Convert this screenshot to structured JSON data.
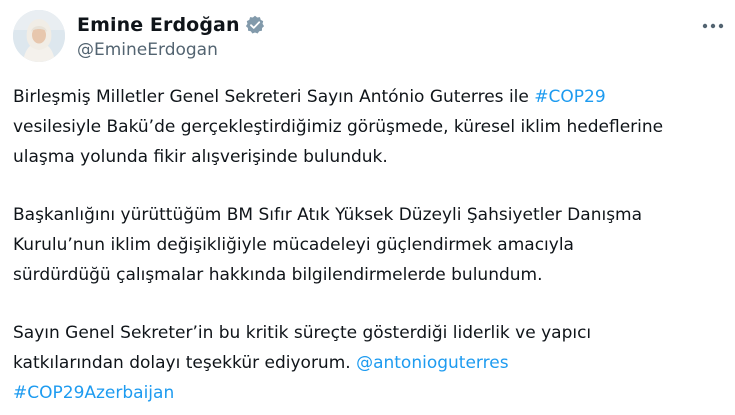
{
  "author": {
    "display_name": "Emine Erdoğan",
    "handle": "@EmineErdogan",
    "verified_icon": "verified-badge-icon",
    "avatar_icon": "profile-avatar"
  },
  "menu": {
    "icon": "more-options-icon"
  },
  "tweet": {
    "p1": {
      "l1_text": "Birleşmiş Milletler Genel Sekreteri Sayın António Guterres ile ",
      "l1_tag": "#COP29",
      "l2": "vesilesiyle Bakü’de gerçekleştirdiğimiz görüşmede, küresel iklim hedeflerine",
      "l3": "ulaşma yolunda fikir alışverişinde bulunduk."
    },
    "p2": {
      "l1": "Başkanlığını yürüttüğüm BM Sıfır Atık Yüksek Düzeyli Şahsiyetler Danışma",
      "l2": "Kurulu’nun iklim değişikliğiyle mücadeleyi güçlendirmek amacıyla",
      "l3": "sürdürdüğü çalışmalar hakkında bilgilendirmelerde bulundum."
    },
    "p3": {
      "l1": "Sayın Genel Sekreter’in bu kritik süreçte gösterdiği liderlik ve yapıcı",
      "l2_text": "katkılarından dolayı teşekkür ediyorum. ",
      "l2_mention": "@antonioguterres",
      "l3_tag": "#COP29Azerbaijan"
    }
  },
  "colors": {
    "link": "#1d9bf0",
    "text": "#0f1419",
    "secondary": "#536471",
    "verified": "#829aab"
  }
}
